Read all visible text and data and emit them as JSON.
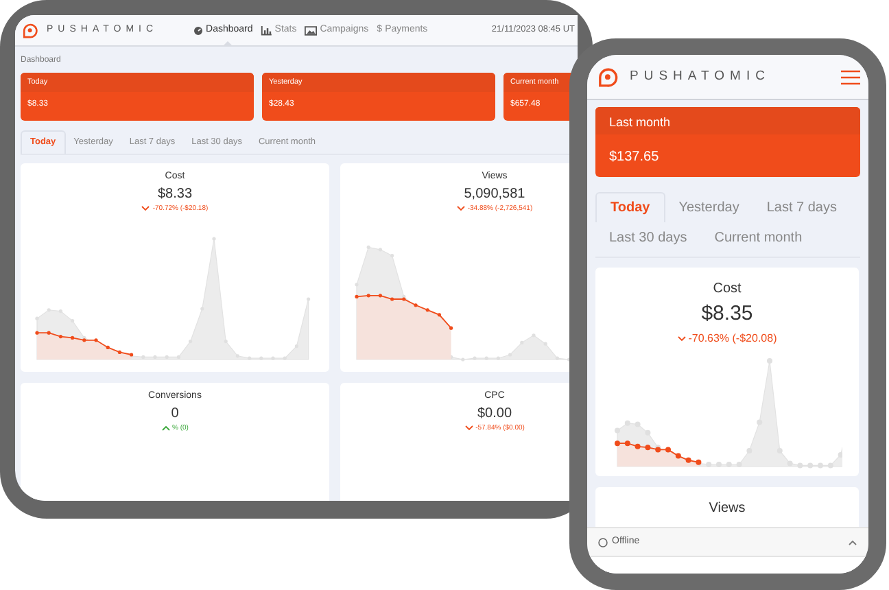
{
  "desktop": {
    "logo": "PUSHATOMIC",
    "nav": [
      {
        "label": "Dashboard",
        "selected": true
      },
      {
        "label": "Stats",
        "selected": false
      },
      {
        "label": "Campaigns",
        "selected": false
      },
      {
        "label": "Payments",
        "selected": false,
        "glyph": "$"
      }
    ],
    "datetime": "21/11/2023 08:45 UT",
    "breadcrumb": "Dashboard",
    "summary_cards": [
      {
        "label": "Today",
        "value": "$8.33"
      },
      {
        "label": "Yesterday",
        "value": "$28.43"
      },
      {
        "label": "Current month",
        "value": "$657.48"
      }
    ],
    "tabs": [
      {
        "label": "Today",
        "selected": true
      },
      {
        "label": "Yesterday",
        "selected": false
      },
      {
        "label": "Last 7 days",
        "selected": false
      },
      {
        "label": "Last 30 days",
        "selected": false
      },
      {
        "label": "Current month",
        "selected": false
      }
    ],
    "metrics": [
      {
        "title": "Cost",
        "value": "$8.33",
        "change": "-70.72% (-$20.18)",
        "negative": true
      },
      {
        "title": "Views",
        "value": "5,090,581",
        "change": "-34.88% (-2,726,541)",
        "negative": true
      },
      {
        "title": "Conversions",
        "value": "0",
        "change": "% (0)",
        "negative": false
      },
      {
        "title": "CPC",
        "value": "$0.00",
        "change": "-57.84% ($0.00)",
        "negative": true
      }
    ]
  },
  "mobile": {
    "logo": "PUSHATOMIC",
    "summary_card": {
      "label": "Last month",
      "value": "$137.65"
    },
    "tabs": [
      {
        "label": "Today",
        "selected": true
      },
      {
        "label": "Yesterday",
        "selected": false
      },
      {
        "label": "Last 7 days",
        "selected": false
      },
      {
        "label": "Last 30 days",
        "selected": false
      },
      {
        "label": "Current month",
        "selected": false
      }
    ],
    "metrics": [
      {
        "title": "Cost",
        "value": "$8.35",
        "change": "-70.63% (-$20.08)",
        "negative": true
      },
      {
        "title": "Views"
      }
    ],
    "status": "Offline"
  }
}
